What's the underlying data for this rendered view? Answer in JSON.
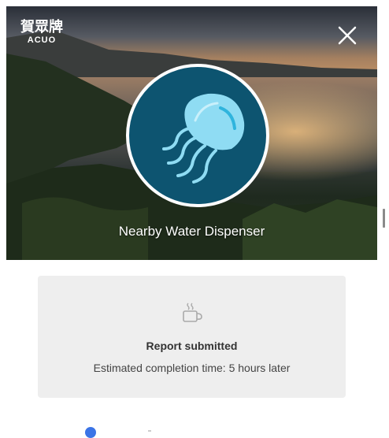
{
  "header": {
    "logo_cn": "賀眾牌",
    "logo_en": "ACUO",
    "close_icon": "close-icon"
  },
  "hero": {
    "title": "Nearby Water Dispenser",
    "avatar_icon": "jellyfish-icon"
  },
  "status": {
    "icon": "coffee-cup-icon",
    "title": "Report submitted",
    "subtitle": "Estimated completion time: 5 hours later"
  },
  "colors": {
    "avatar_bg": "#0d5470",
    "jellyfish": "#8fdcf3",
    "card_bg": "#eeeeee",
    "accent": "#3b74e6"
  }
}
